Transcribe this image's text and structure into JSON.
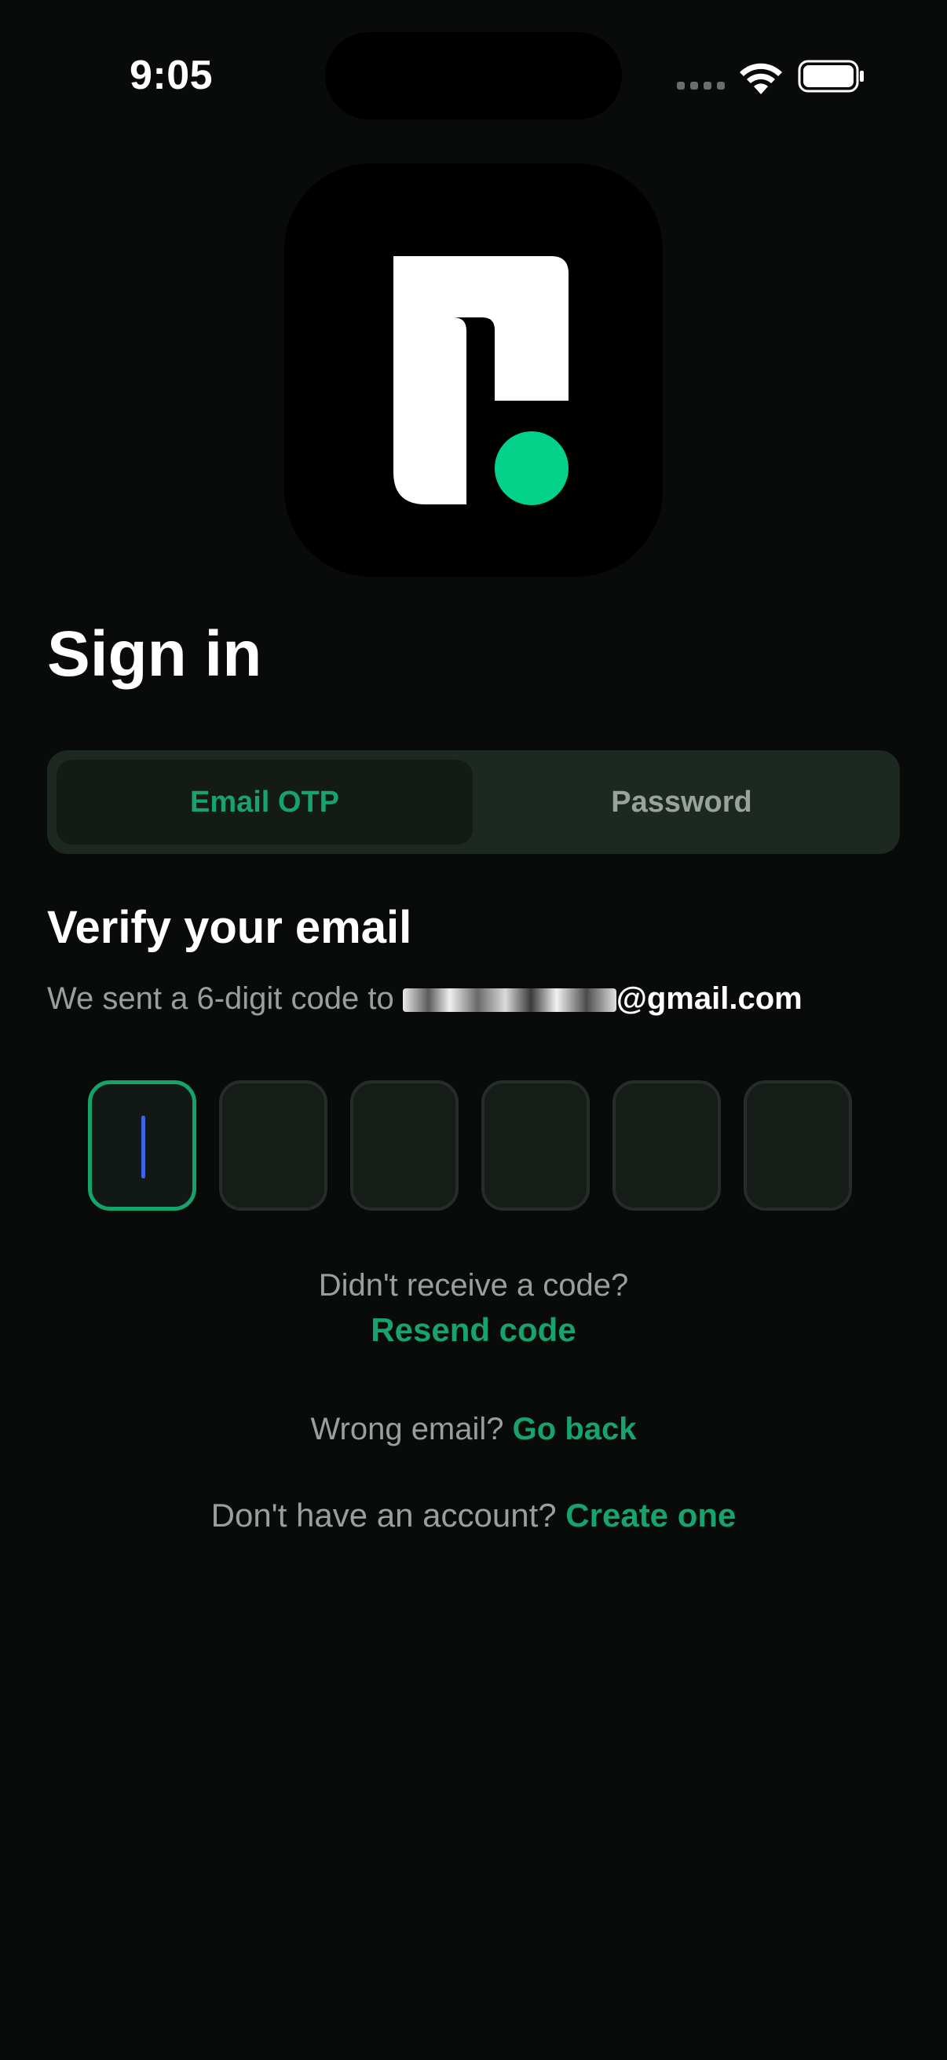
{
  "status_bar": {
    "time": "9:05"
  },
  "logo": {
    "icon": "app-logo-icon",
    "colors": {
      "background": "#000000",
      "mark": "#ffffff",
      "dot": "#03d38a"
    }
  },
  "page": {
    "title": "Sign in"
  },
  "auth_mode_tabs": {
    "options": [
      "Email OTP",
      "Password"
    ],
    "selected": "Email OTP"
  },
  "verify": {
    "heading": "Verify your email",
    "sent_prefix": "We sent a 6-digit code to ",
    "email_visible_suffix": "@gmail.com"
  },
  "otp": {
    "length": 6,
    "digits": [
      "",
      "",
      "",
      "",
      "",
      ""
    ],
    "focused_index": 0
  },
  "resend": {
    "prompt": "Didn't receive a code?",
    "link": "Resend code"
  },
  "wrong_email": {
    "prompt": "Wrong email?",
    "link": "Go back"
  },
  "signup": {
    "prompt": "Don't have an account?",
    "link": "Create one"
  },
  "colors": {
    "background": "#090b0a",
    "accent": "#16a36d",
    "caret": "#3f63e6",
    "muted_text": "#9a9f9c"
  }
}
